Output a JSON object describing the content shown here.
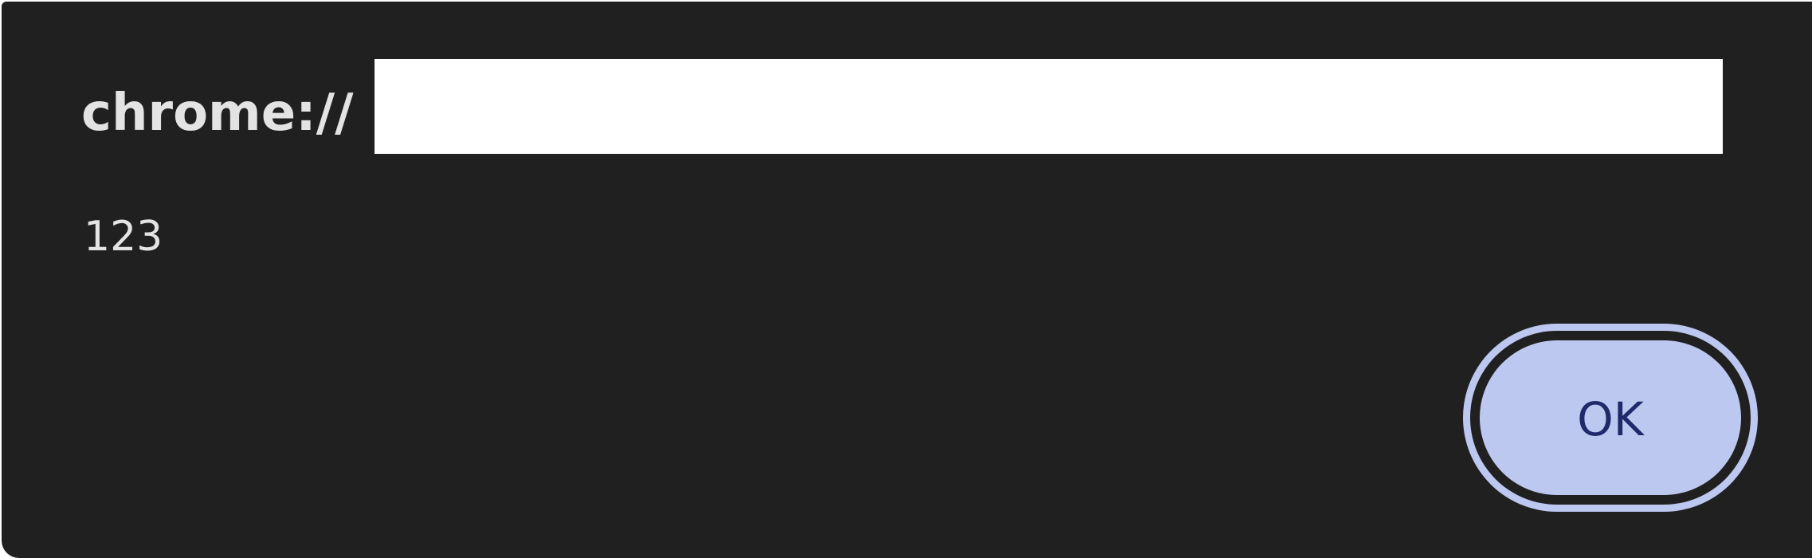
{
  "dialog": {
    "title": "chrome://",
    "message": "123",
    "ok_label": "OK"
  },
  "colors": {
    "dialog_background": "#202020",
    "text": "#e3e3e3",
    "button_fill": "#bdc8f0",
    "button_text": "#202a6b",
    "redaction": "#ffffff"
  }
}
